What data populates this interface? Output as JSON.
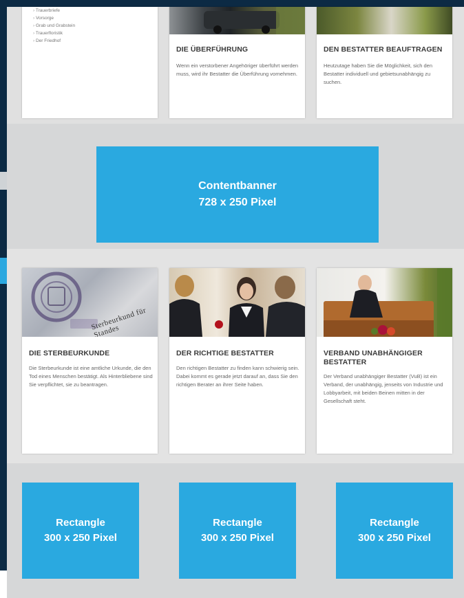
{
  "sidebar_list": {
    "items": [
      "Trauerbriefe",
      "Vorsorge",
      "Grab und Grabstein",
      "Trauerfloristik",
      "Der Friedhof"
    ]
  },
  "top_cards": [
    {
      "title": "DIE ÜBERFÜHRUNG",
      "text": "Wenn ein verstorbener Angehöriger überführt werden muss, wird ihr Bestatter die Überführung vornehmen."
    },
    {
      "title": "DEN BESTATTER BEAUFTRAGEN",
      "text": "Heutzutage haben Sie die Möglichkeit, sich den Bestatter individuell und gebietsunabhängig zu suchen."
    }
  ],
  "content_banner": {
    "line1": "Contentbanner",
    "line2": "728 x 250 Pixel"
  },
  "cards": [
    {
      "title": "DIE STERBEURKUNDE",
      "text": "Die Sterbeurkunde ist eine amtliche Urkunde, die den Tod eines Menschen bestätigt. Als Hinterbliebene sind Sie verpflichtet, sie zu beantragen.",
      "image": "stamp-document-image",
      "image_text": "Sterbeurkund für Standes"
    },
    {
      "title": "DER RICHTIGE BESTATTER",
      "text": "Den richtigen Bestatter zu finden kann schwierig sein. Dabei kommt es gerade jetzt darauf an, dass Sie den richtigen Berater an ihrer Seite haben.",
      "image": "consultation-meeting-image"
    },
    {
      "title": "VERBAND UNABHÄNGIGER BESTATTER",
      "text": "Der Verband unabhängiger Bestatter (VuB) ist ein Verband, der unabhängig, jenseits von Industrie und Lobbyarbeit, mit beiden Beinen mitten in der Gesellschaft steht.",
      "image": "undertaker-coffin-image"
    }
  ],
  "rectangles": [
    {
      "line1": "Rectangle",
      "line2": "300 x 250 Pixel"
    },
    {
      "line1": "Rectangle",
      "line2": "300 x 250 Pixel"
    },
    {
      "line1": "Rectangle",
      "line2": "300 x 250 Pixel"
    }
  ],
  "colors": {
    "ad_blue": "#2aa9e0",
    "navy": "#0c2a44",
    "background_grey": "#d6d7d8"
  }
}
